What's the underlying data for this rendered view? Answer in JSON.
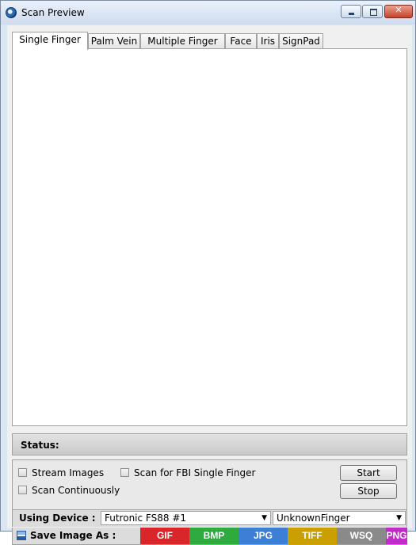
{
  "window": {
    "title": "Scan Preview",
    "min_glyph": "",
    "max_glyph": "",
    "close_glyph": "✕"
  },
  "tabs": [
    {
      "label": "Single Finger",
      "active": true
    },
    {
      "label": "Palm Vein",
      "active": false
    },
    {
      "label": "Multiple Finger",
      "active": false
    },
    {
      "label": "Face",
      "active": false
    },
    {
      "label": "Iris",
      "active": false
    },
    {
      "label": "SignPad",
      "active": false
    }
  ],
  "status": {
    "label": "Status:",
    "value": ""
  },
  "options": {
    "stream_images": {
      "label": "Stream Images",
      "checked": false
    },
    "scan_fbi": {
      "label": "Scan for FBI Single Finger",
      "checked": false
    },
    "scan_continuously": {
      "label": "Scan Continuously",
      "checked": false
    }
  },
  "buttons": {
    "start": "Start",
    "stop": "Stop"
  },
  "device": {
    "label": "Using Device :",
    "selected_device": "Futronic FS88 #1",
    "selected_finger": "UnknownFinger",
    "arrow_icon": "▼"
  },
  "save": {
    "label": "Save Image As :",
    "icon": "save-icon",
    "formats": [
      {
        "label": "GIF",
        "color": "#d9262b"
      },
      {
        "label": "BMP",
        "color": "#2eaa3f"
      },
      {
        "label": "JPG",
        "color": "#3b7fd6"
      },
      {
        "label": "TIFF",
        "color": "#c9a000"
      },
      {
        "label": "WSQ",
        "color": "#8a8a8a"
      },
      {
        "label": "PNG",
        "color": "#c02bc9"
      }
    ]
  }
}
